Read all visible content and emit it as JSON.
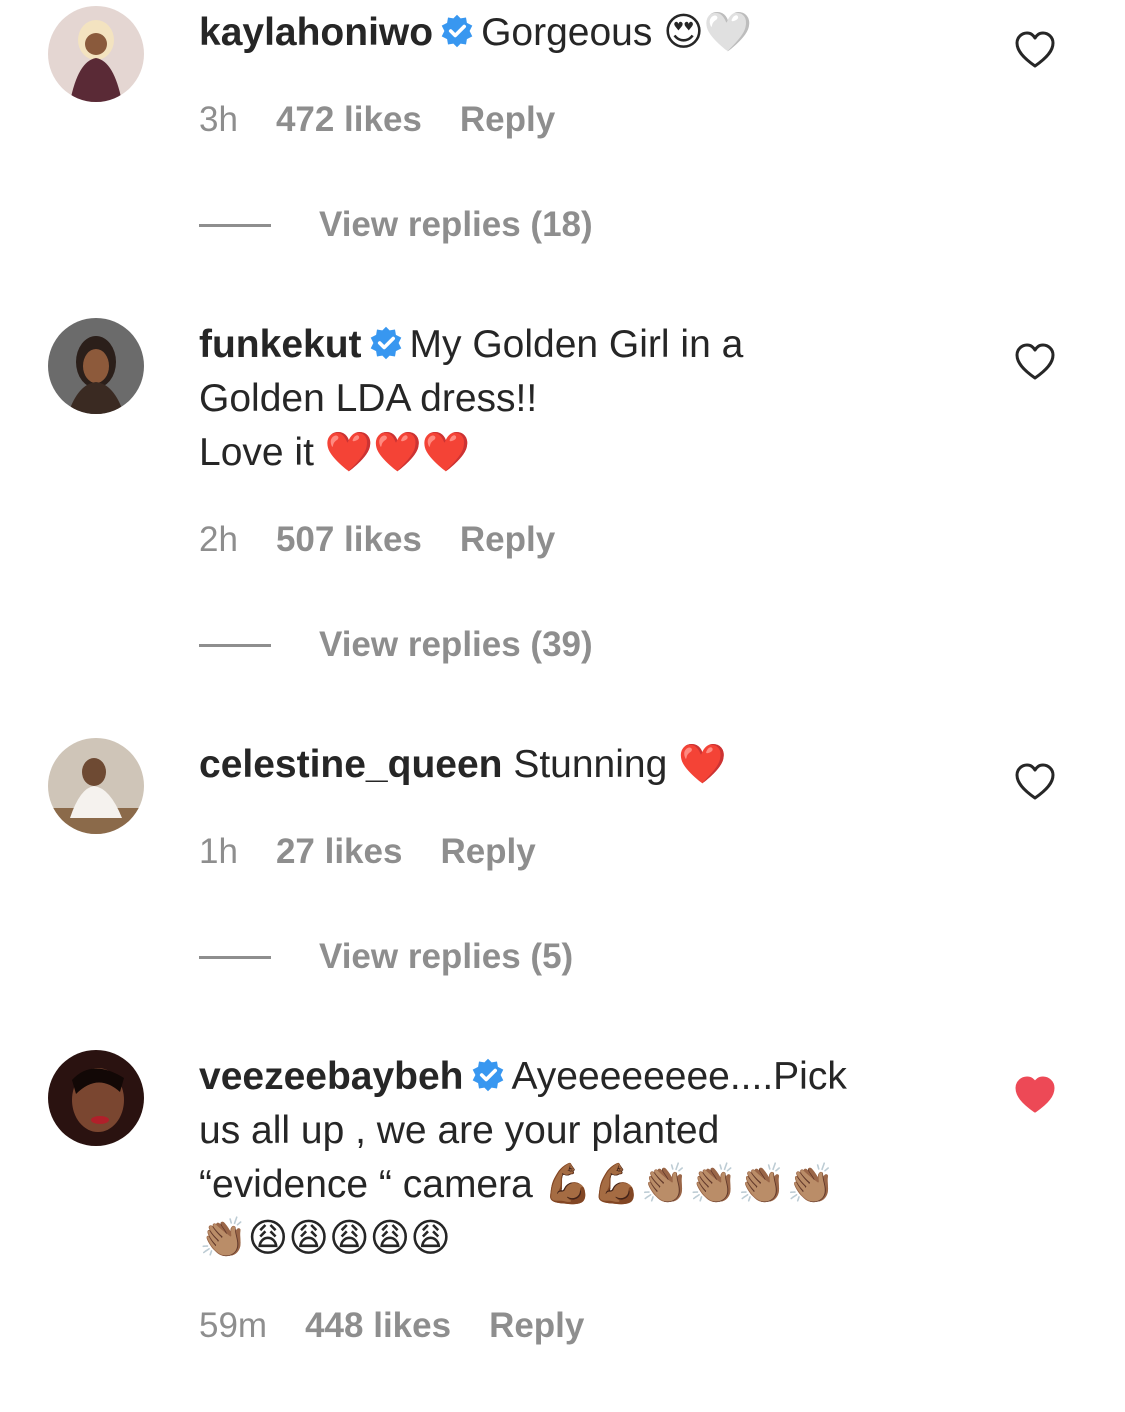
{
  "comments": [
    {
      "username": "kaylahoniwo",
      "verified": true,
      "text_lines": [
        "Gorgeous 😍🤍"
      ],
      "time": "3h",
      "likes": "472 likes",
      "reply_label": "Reply",
      "view_replies": "View replies (18)",
      "liked": false,
      "avatar_colors": [
        "#e8c9c2",
        "#5a2a36"
      ]
    },
    {
      "username": "funkekut",
      "verified": true,
      "text_lines": [
        "My Golden Girl in a",
        "Golden LDA dress!!",
        "Love it ❤️❤️❤️"
      ],
      "time": "2h",
      "likes": "507 likes",
      "reply_label": "Reply",
      "view_replies": "View replies (39)",
      "liked": false,
      "avatar_colors": [
        "#6b6b6b",
        "#2b1f1a"
      ]
    },
    {
      "username": "celestine_queen",
      "verified": false,
      "text_lines": [
        "Stunning ❤️"
      ],
      "time": "1h",
      "likes": "27 likes",
      "reply_label": "Reply",
      "view_replies": "View replies (5)",
      "liked": false,
      "avatar_colors": [
        "#d9d2c7",
        "#7a5c3e"
      ]
    },
    {
      "username": "veezeebaybeh",
      "verified": true,
      "text_lines": [
        "Ayeeeeeeee....Pick",
        "us all up , we are your planted",
        "“evidence “ camera 💪🏾💪🏾👏🏽👏🏽👏🏽👏🏽",
        "👏🏽😩😩😩😩😩"
      ],
      "time": "59m",
      "likes": "448 likes",
      "reply_label": "Reply",
      "view_replies": "",
      "liked": true,
      "avatar_colors": [
        "#3a1c18",
        "#b1202a"
      ]
    }
  ],
  "colors": {
    "text": "#262626",
    "meta": "#8e8e8e",
    "verified_blue": "#3897f0",
    "liked_red": "#ed4956"
  }
}
